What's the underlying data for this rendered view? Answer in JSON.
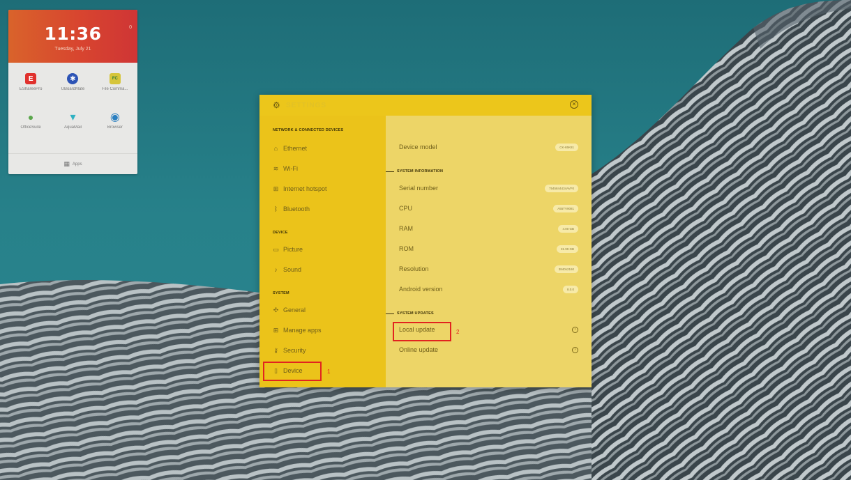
{
  "widget": {
    "time": "11:36",
    "date": "Tuesday, July 21",
    "dot": "0",
    "apps": [
      {
        "label": "EShareePro",
        "icon": "eshare-icon",
        "color": "#e0312d",
        "glyph": "E"
      },
      {
        "label": "UBoardMate",
        "icon": "uboardmate-icon",
        "color": "#2c53b5",
        "glyph": "✱"
      },
      {
        "label": "File Comma...",
        "icon": "file-commander-icon",
        "color": "#d6c53a",
        "glyph": "FC"
      },
      {
        "label": "OfficeSuite",
        "icon": "officesuite-icon",
        "color": "#5aa64b",
        "glyph": "●"
      },
      {
        "label": "AquaMail",
        "icon": "aquamail-icon",
        "color": "#2fb1c2",
        "glyph": "▾"
      },
      {
        "label": "Browser",
        "icon": "browser-icon",
        "color": "#2a7fc0",
        "glyph": "◉"
      }
    ],
    "apps_label": "Apps"
  },
  "dialog": {
    "title": "SETTINGS",
    "nav": {
      "section_network": "NETWORK & CONNECTED DEVICES",
      "ethernet": "Ethernet",
      "wifi": "Wi-Fi",
      "hotspot": "Internet hotspot",
      "bluetooth": "Bluetooth",
      "section_device": "DEVICE",
      "picture": "Picture",
      "sound": "Sound",
      "section_system": "SYSTEM",
      "general": "General",
      "manage_apps": "Manage apps",
      "security": "Security",
      "device": "Device"
    },
    "content": {
      "device_model_label": "Device model",
      "device_model_value": "CK-65K81",
      "section_system_info": "SYSTEM INFORMATION",
      "serial_label": "Serial number",
      "serial_value": "7545844434AVF0",
      "cpu_label": "CPU",
      "cpu_value": "A55TV9081",
      "ram_label": "RAM",
      "ram_value": "4.00 GB",
      "rom_label": "ROM",
      "rom_value": "31.99 GB",
      "resolution_label": "Resolution",
      "resolution_value": "3840x2160",
      "android_label": "Android version",
      "android_value": "8.0.0",
      "section_updates": "SYSTEM UPDATES",
      "local_update": "Local update",
      "online_update": "Online update"
    },
    "markers": {
      "one": "1",
      "two": "2"
    }
  },
  "colors": {
    "wallpaper": "#1f6e78",
    "header": "#ecc61b",
    "nav": "#ebc31a",
    "content": "#edd567",
    "highlight": "#e2231f"
  }
}
